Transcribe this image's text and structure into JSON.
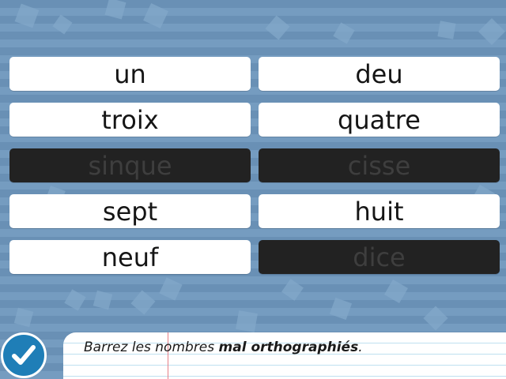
{
  "words": [
    "un",
    "deu",
    "troix",
    "quatre",
    "sinque",
    "cisse",
    "sept",
    "huit",
    "neuf",
    "dice"
  ],
  "struck": [
    false,
    false,
    false,
    false,
    true,
    true,
    false,
    false,
    false,
    true
  ],
  "instruction": {
    "prefix": "Barrez les nombres ",
    "bold": "mal orthographiés",
    "suffix": "."
  },
  "check_button": {
    "icon": "checkmark-icon"
  },
  "colors": {
    "background": "#6c93b8",
    "tile": "#ffffff",
    "tile_struck": "#222222",
    "check_button": "#1f7eb7"
  }
}
